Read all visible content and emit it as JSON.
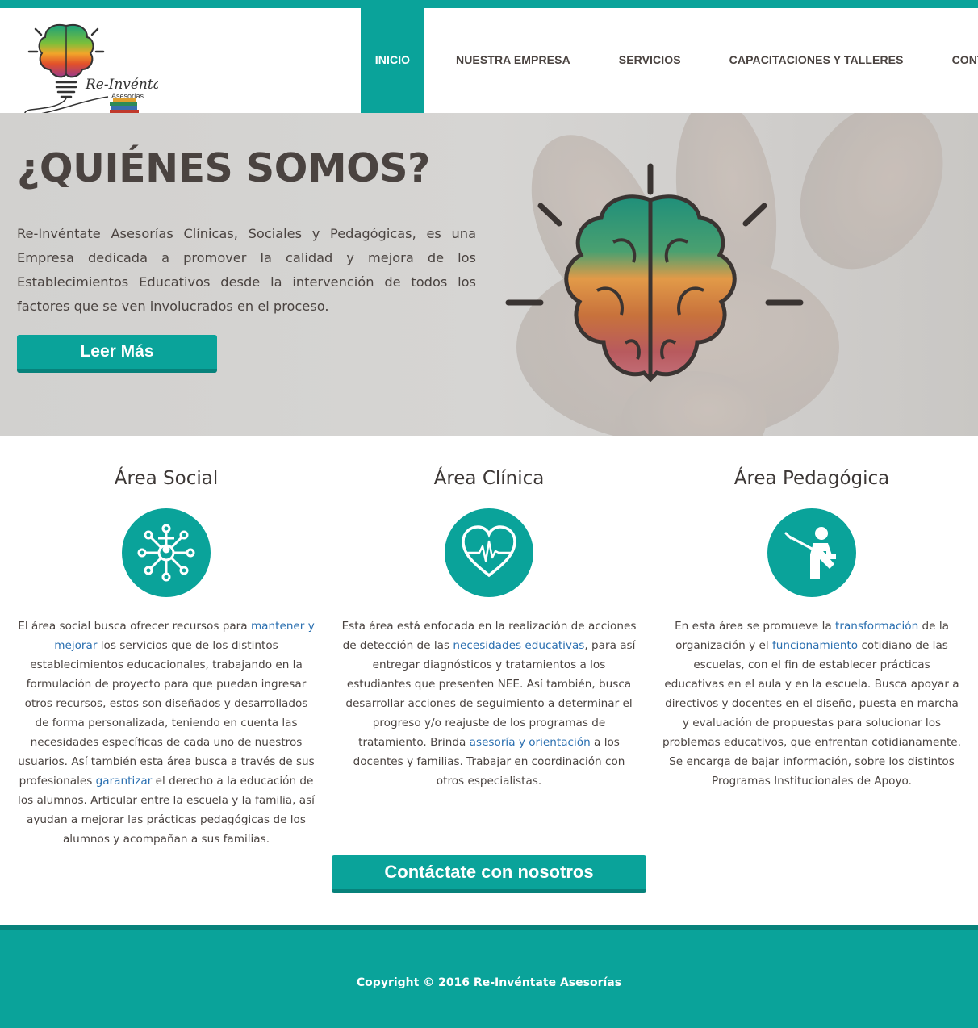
{
  "brand": {
    "logo_title": "Re-Invéntate",
    "logo_subtitle": "Asesorías"
  },
  "nav": {
    "items": [
      {
        "label": "INICIO",
        "active": true
      },
      {
        "label": "NUESTRA EMPRESA",
        "active": false
      },
      {
        "label": "SERVICIOS",
        "active": false
      },
      {
        "label": "CAPACITACIONES Y TALLERES",
        "active": false
      },
      {
        "label": "CONTACTO",
        "active": false
      }
    ]
  },
  "hero": {
    "title": "¿QUIÉNES SOMOS?",
    "text": "Re-Invéntate Asesorías Clínicas, Sociales y Pedagógicas, es una Empresa dedicada a promover la calidad y mejora de los Establecimientos Educativos desde la intervención de todos los factores que se ven involucrados en el proceso.",
    "button_label": "Leer Más"
  },
  "areas": [
    {
      "title": "Área Social",
      "icon": "network-icon",
      "parts": [
        {
          "text": "El área social busca ofrecer recursos para ",
          "link": false
        },
        {
          "text": "mantener y mejorar",
          "link": true
        },
        {
          "text": " los servicios que de los distintos establecimientos educacionales, trabajando en la formulación de proyecto para que puedan ingresar otros recursos, estos son diseñados y desarrollados de forma personalizada, teniendo en cuenta las necesidades específicas de cada uno de nuestros usuarios. Así también esta área busca a través de sus profesionales ",
          "link": false
        },
        {
          "text": "garantizar",
          "link": true
        },
        {
          "text": " el derecho a la educación de los alumnos. Articular entre la escuela y la familia, así ayudan a mejorar las prácticas pedagógicas de los alumnos y acompañan a sus familias.",
          "link": false
        }
      ]
    },
    {
      "title": "Área Clínica",
      "icon": "heart-pulse-icon",
      "parts": [
        {
          "text": "Esta área está enfocada en la realización de acciones de detección de las ",
          "link": false
        },
        {
          "text": "necesidades educativas",
          "link": true
        },
        {
          "text": ", para así entregar diagnósticos y tratamientos a los estudiantes que presenten NEE. Así también, busca desarrollar acciones de seguimiento a determinar el progreso y/o reajuste de los programas de tratamiento. Brinda ",
          "link": false
        },
        {
          "text": "asesoría y orientación",
          "link": true
        },
        {
          "text": " a los docentes y familias. Trabajar en coordinación con otros especialistas.",
          "link": false
        }
      ]
    },
    {
      "title": "Área Pedagógica",
      "icon": "teacher-icon",
      "parts": [
        {
          "text": "En esta área se promueve la ",
          "link": false
        },
        {
          "text": "transformación",
          "link": true
        },
        {
          "text": " de la organización y el ",
          "link": false
        },
        {
          "text": "funcionamiento",
          "link": true
        },
        {
          "text": " cotidiano de las escuelas, con el fin de establecer prácticas educativas en el aula y en la escuela. Busca apoyar a directivos y docentes en el diseño, puesta en marcha y evaluación de propuestas para solucionar los problemas educativos, que enfrentan cotidianamente. Se encarga de bajar información, sobre los distintos Programas Institucionales de Apoyo.",
          "link": false
        }
      ]
    }
  ],
  "contact_button": "Contáctate con nosotros",
  "footer": {
    "copyright": "Copyright © 2016 Re-Invéntate Asesorías"
  },
  "colors": {
    "accent": "#0aa39a",
    "accent_dark": "#07827b",
    "text": "#4a4340",
    "link": "#2a6fb0"
  }
}
